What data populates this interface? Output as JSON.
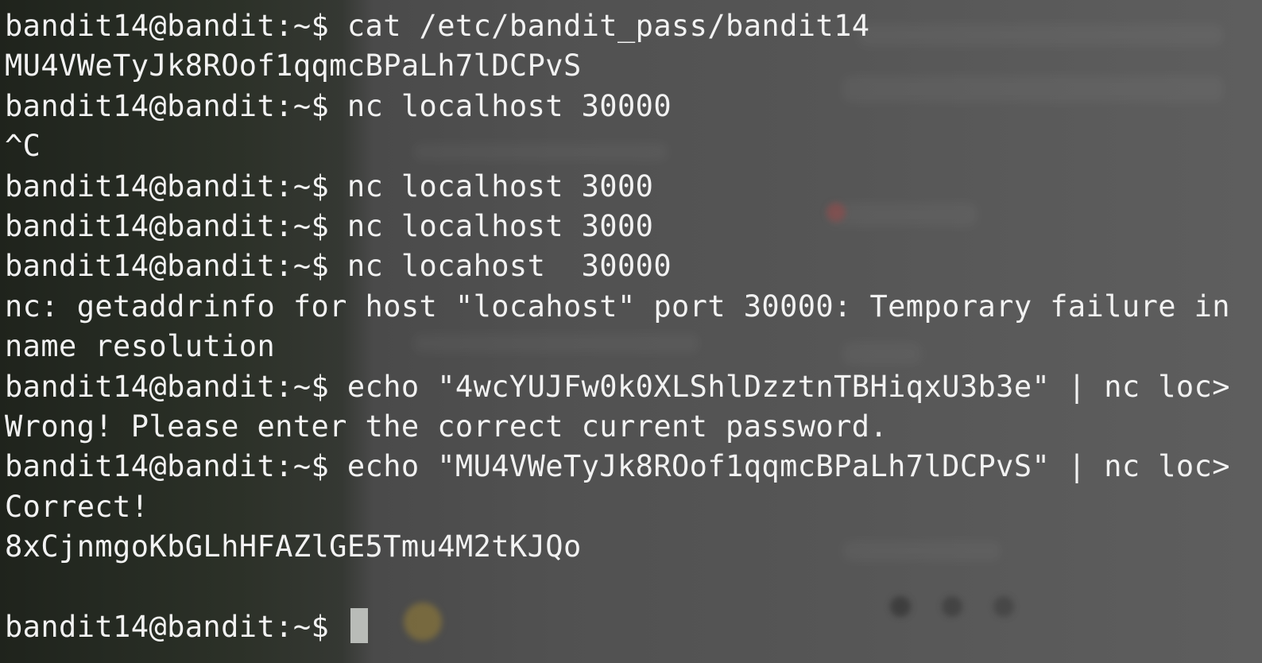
{
  "terminal": {
    "prompt": "bandit14@bandit:~$ ",
    "lines": [
      {
        "kind": "command",
        "prompt": "bandit14@bandit:~$ ",
        "text": "cat /etc/bandit_pass/bandit14"
      },
      {
        "kind": "output",
        "text": "MU4VWeTyJk8ROof1qqmcBPaLh7lDCPvS"
      },
      {
        "kind": "command",
        "prompt": "bandit14@bandit:~$ ",
        "text": "nc localhost 30000"
      },
      {
        "kind": "output",
        "text": "^C"
      },
      {
        "kind": "command",
        "prompt": "bandit14@bandit:~$ ",
        "text": "nc localhost 3000"
      },
      {
        "kind": "command",
        "prompt": "bandit14@bandit:~$ ",
        "text": "nc localhost 3000"
      },
      {
        "kind": "command",
        "prompt": "bandit14@bandit:~$ ",
        "text": "nc locahost  30000"
      },
      {
        "kind": "output",
        "text": "nc: getaddrinfo for host \"locahost\" port 30000: Temporary failure in"
      },
      {
        "kind": "output",
        "text": "name resolution"
      },
      {
        "kind": "command",
        "prompt": "bandit14@bandit:~$ ",
        "text": "echo \"4wcYUJFw0k0XLShlDzztnTBHiqxU3b3e\" | nc loc>"
      },
      {
        "kind": "output",
        "text": "Wrong! Please enter the correct current password."
      },
      {
        "kind": "command",
        "prompt": "bandit14@bandit:~$ ",
        "text": "echo \"MU4VWeTyJk8ROof1qqmcBPaLh7lDCPvS\" | nc loc>"
      },
      {
        "kind": "output",
        "text": "Correct!"
      },
      {
        "kind": "output",
        "text": "8xCjnmgoKbGLhHFAZlGE5Tmu4M2tKJQo"
      },
      {
        "kind": "output",
        "text": ""
      },
      {
        "kind": "command",
        "prompt": "bandit14@bandit:~$ ",
        "text": ""
      }
    ]
  },
  "colors": {
    "foreground": "#f2f2f2",
    "cursor": "#b9bcb8",
    "background": "#555555"
  }
}
